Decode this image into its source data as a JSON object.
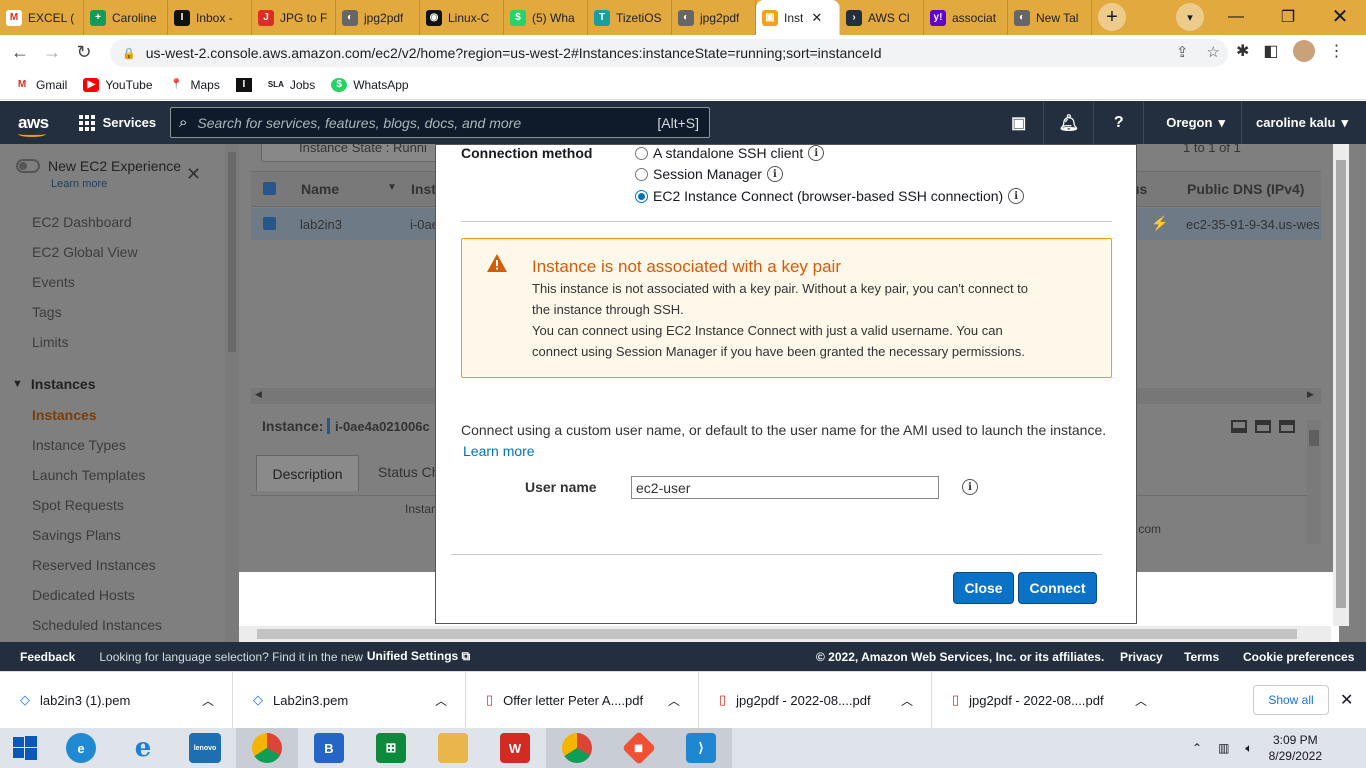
{
  "browser": {
    "tabs": [
      {
        "label": "EXCEL (",
        "icon": "gmail-icon"
      },
      {
        "label": "Caroline",
        "icon": "sheets-icon"
      },
      {
        "label": "Inbox -",
        "icon": "outlook-icon"
      },
      {
        "label": "JPG to F",
        "icon": "jpg2pdf-icon"
      },
      {
        "label": "jpg2pdf",
        "icon": "globe-icon"
      },
      {
        "label": "Linux-C",
        "icon": "github-icon"
      },
      {
        "label": "(5) Wha",
        "icon": "whatsapp-icon"
      },
      {
        "label": "TizetiOS",
        "icon": "tizeti-icon"
      },
      {
        "label": "jpg2pdf",
        "icon": "globe-icon"
      },
      {
        "label": "Inst",
        "icon": "aws-cube-icon",
        "active": true
      },
      {
        "label": "AWS Cl",
        "icon": "terminal-icon"
      },
      {
        "label": "associat",
        "icon": "yahoo-icon"
      },
      {
        "label": "New Tal",
        "icon": "globe-icon"
      }
    ],
    "url": "us-west-2.console.aws.amazon.com/ec2/v2/home?region=us-west-2#Instances:instanceState=running;sort=instanceId",
    "bookmarks": [
      "Gmail",
      "YouTube",
      "Maps",
      "",
      "Jobs",
      "WhatsApp"
    ]
  },
  "aws_header": {
    "logo": "aws",
    "services": "Services",
    "search_placeholder": "Search for services, features, blogs, docs, and more",
    "search_shortcut": "[Alt+S]",
    "region": "Oregon",
    "user": "caroline kalu"
  },
  "sidebar": {
    "new_experience": "New EC2 Experience",
    "learn_more": "Learn more",
    "items": [
      "EC2 Dashboard",
      "EC2 Global View",
      "Events",
      "Tags",
      "Limits"
    ],
    "section": "Instances",
    "sub_items": [
      "Instances",
      "Instance Types",
      "Launch Templates",
      "Spot Requests",
      "Savings Plans",
      "Reserved Instances",
      "Dedicated Hosts",
      "Scheduled Instances"
    ]
  },
  "main_bg": {
    "filter_chip": "Instance State : Runni",
    "pagination": "1 to 1 of 1",
    "col_name": "Name",
    "col_inst": "Inst",
    "col_status": "us",
    "col_dns": "Public DNS (IPv4)",
    "row_name": "lab2in3",
    "row_id": "i-0ae",
    "row_dns": "ec2-35-91-9-34.us-wes",
    "instance_label": "Instance:",
    "instance_id": "i-0ae4a021006c",
    "tab_description": "Description",
    "tab_status": "Status Ch",
    "desc_text": "Instar",
    "dns_tail": ".com"
  },
  "modal": {
    "connection_method_label": "Connection method",
    "options": [
      "A standalone SSH client",
      "Session Manager",
      "EC2 Instance Connect (browser-based SSH connection)"
    ],
    "selected_option": 2,
    "warning_title": "Instance is not associated with a key pair",
    "warning_lines": [
      "This instance is not associated with a key pair. Without a key pair, you can't connect to",
      "the instance through SSH.",
      "You can connect using EC2 Instance Connect with just a valid username. You can",
      "connect using Session Manager if you have been granted the necessary permissions."
    ],
    "connect_text": "Connect using a custom user name, or default to the user name for the AMI used to launch the instance.",
    "learn_more": "Learn more",
    "user_name_label": "User name",
    "user_name_value": "ec2-user",
    "close_button": "Close",
    "connect_button": "Connect"
  },
  "footer": {
    "feedback": "Feedback",
    "language_prompt": "Looking for language selection? Find it in the new",
    "unified_settings": "Unified Settings",
    "copyright": "© 2022, Amazon Web Services, Inc. or its affiliates.",
    "privacy": "Privacy",
    "terms": "Terms",
    "cookies": "Cookie preferences"
  },
  "downloads": {
    "items": [
      "lab2in3 (1).pem",
      "Lab2in3.pem",
      "Offer letter Peter A....pdf",
      "jpg2pdf - 2022-08....pdf",
      "jpg2pdf - 2022-08....pdf"
    ],
    "show_all": "Show all"
  },
  "taskbar": {
    "time": "3:09 PM",
    "date": "8/29/2022"
  },
  "colors": {
    "tabstrip": "#e2a93f",
    "aws_header": "#232f3e",
    "warning_border": "#ff9900",
    "warning_title": "#d45b07",
    "primary_button": "#0b73c7",
    "link": "#0073bb"
  }
}
